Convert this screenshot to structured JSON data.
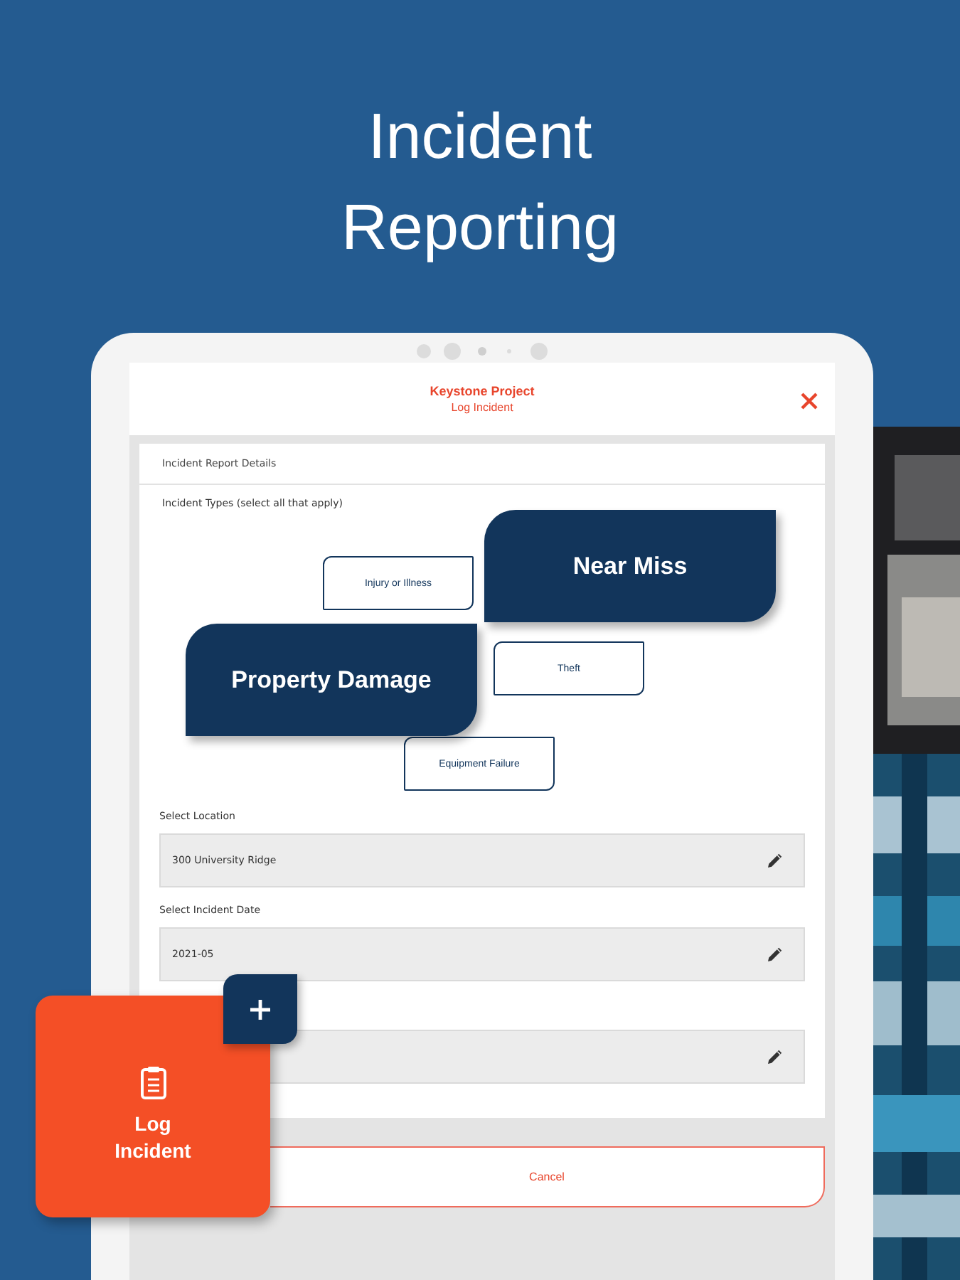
{
  "headline": "Incident Reporting",
  "header": {
    "project": "Keystone Project",
    "subtitle": "Log Incident"
  },
  "section_title": "Incident Report Details",
  "incident_types": {
    "label": "Incident Types (select all that apply)",
    "options": [
      {
        "label": "Injury or Illness",
        "selected": false
      },
      {
        "label": "Near Miss",
        "selected": true
      },
      {
        "label": "Property Damage",
        "selected": true
      },
      {
        "label": "Theft",
        "selected": false
      },
      {
        "label": "Equipment Failure",
        "selected": false
      }
    ]
  },
  "fields": [
    {
      "label": "Select Location",
      "value": "300 University Ridge"
    },
    {
      "label": "Select Incident Date",
      "value": "2021-05"
    }
  ],
  "cancel_button": "Cancel",
  "fab": {
    "label": "Log Incident"
  }
}
